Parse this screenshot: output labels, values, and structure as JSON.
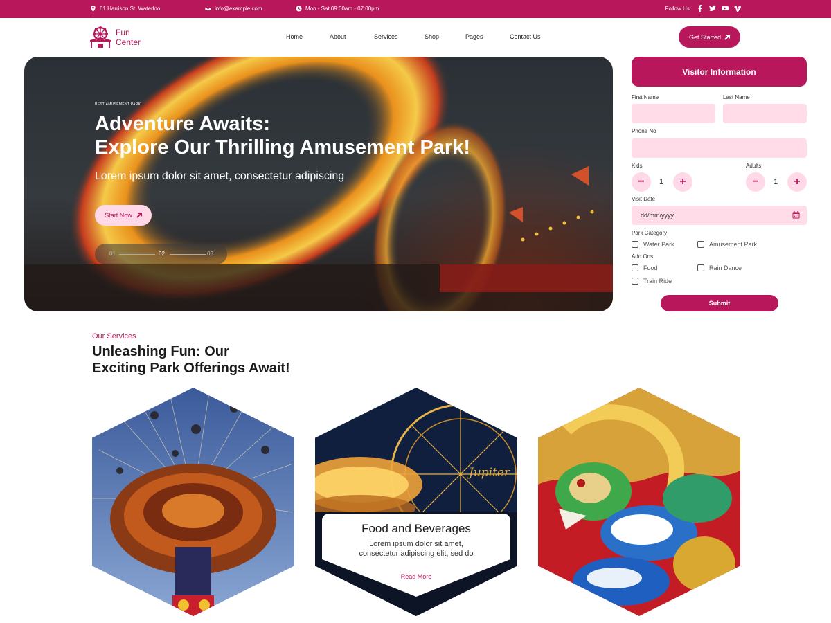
{
  "topbar": {
    "address": "61 Harrison St. Waterloo",
    "email": "info@example.com",
    "hours": "Mon - Sat 09:00am - 07:00pm",
    "follow_label": "Follow Us:"
  },
  "brand": {
    "name": "Fun Center",
    "color": "#b8175c"
  },
  "nav": {
    "items": [
      "Home",
      "About",
      "Services",
      "Shop",
      "Pages",
      "Contact Us"
    ],
    "cta_label": "Get Started"
  },
  "hero": {
    "eyebrow": "BEST AMUSEMENT PARK",
    "title_line1": "Adventure Awaits:",
    "title_line2": "Explore Our Thrilling Amusement Park!",
    "subtitle": "Lorem ipsum dolor sit amet, consectetur adipiscing",
    "button_label": "Start Now",
    "pager": [
      "01",
      "02",
      "03"
    ],
    "active_slide": 2
  },
  "form": {
    "title": "Visitor Information",
    "first_name_label": "First Name",
    "last_name_label": "Last Name",
    "phone_label": "Phone No",
    "kids_label": "Kids",
    "kids_value": "1",
    "adults_label": "Adults",
    "adults_value": "1",
    "visit_date_label": "Visit Date",
    "visit_date_placeholder": "dd/mm/yyyy",
    "park_category_label": "Park Category",
    "park_categories": [
      "Water Park",
      "Amusement Park"
    ],
    "addons_label": "Add Ons",
    "addons": [
      "Food",
      "Rain Dance",
      "Train Ride"
    ],
    "submit_label": "Submit"
  },
  "services": {
    "eyebrow": "Our Services",
    "title_line1": "Unleashing Fun: Our",
    "title_line2": "Exciting Park Offerings Await!",
    "featured_card": {
      "title": "Food and Beverages",
      "desc_line1": "Lorem ipsum dolor sit amet,",
      "desc_line2": "consectetur adipiscing elit, sed do",
      "link": "Read More"
    },
    "sign_text": "Jupiter"
  }
}
